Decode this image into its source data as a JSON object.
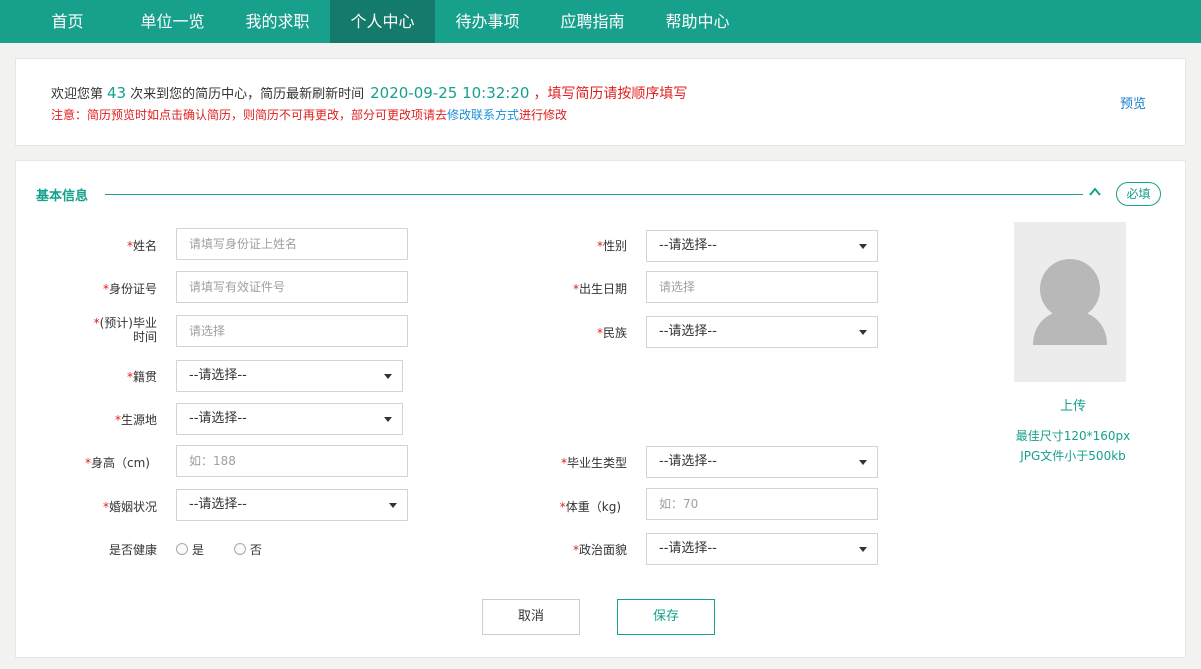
{
  "nav": {
    "items": [
      {
        "label": "首页"
      },
      {
        "label": "单位一览"
      },
      {
        "label": "我的求职"
      },
      {
        "label": "个人中心"
      },
      {
        "label": "待办事项"
      },
      {
        "label": "应聘指南"
      },
      {
        "label": "帮助中心"
      }
    ],
    "active_index": 3
  },
  "notice": {
    "prefix": "欢迎您第",
    "visit_count": "43",
    "middle": "次来到您的简历中心，简历最新刷新时间",
    "refresh_time": "2020-09-25 10:32:20",
    "comma": "，",
    "fill_order": "填写简历请按顺序填写",
    "warning_prefix": "注意：简历预览时如点击确认简历，则简历不可再更改，部分可更改项请去",
    "warning_link": "修改联系方式",
    "warning_suffix": "进行修改",
    "preview_label": "预览"
  },
  "section": {
    "title": "基本信息",
    "required_badge": "必填"
  },
  "form": {
    "star": "*",
    "name": {
      "label": "姓名",
      "placeholder": "请填写身份证上姓名"
    },
    "id_number": {
      "label": "身份证号",
      "placeholder": "请填写有效证件号"
    },
    "grad_time": {
      "label_line1": "(预计)毕业",
      "label_line2": "时间",
      "placeholder": "请选择"
    },
    "native_place": {
      "label": "籍贯",
      "value": "--请选择--"
    },
    "origin": {
      "label": "生源地",
      "value": "--请选择--"
    },
    "height": {
      "label": "身高（cm)",
      "placeholder": "如：188"
    },
    "marital": {
      "label": "婚姻状况",
      "value": "--请选择--"
    },
    "healthy": {
      "label": "是否健康",
      "yes": "是",
      "no": "否"
    },
    "gender": {
      "label": "性别",
      "value": "--请选择--"
    },
    "birth_date": {
      "label": "出生日期",
      "placeholder": "请选择"
    },
    "ethnicity": {
      "label": "民族",
      "value": "--请选择--"
    },
    "graduate_type": {
      "label": "毕业生类型",
      "value": "--请选择--"
    },
    "weight": {
      "label": "体重（kg)",
      "placeholder": "如：70"
    },
    "political": {
      "label": "政治面貌",
      "value": "--请选择--"
    }
  },
  "photo": {
    "upload_label": "上传",
    "hint_size": "最佳尺寸120*160px",
    "hint_file": "JPG文件小于500kb"
  },
  "buttons": {
    "cancel": "取消",
    "save": "保存"
  },
  "colors": {
    "accent": "#17a08c",
    "nav_active": "#137a6c",
    "warning": "#e02020",
    "link": "#1a8fd8"
  }
}
